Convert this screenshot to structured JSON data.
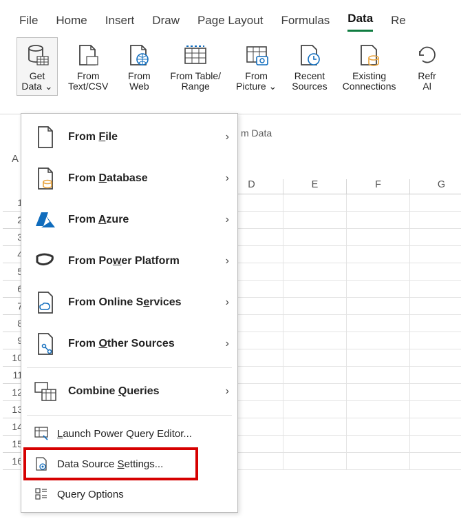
{
  "tabs": [
    "File",
    "Home",
    "Insert",
    "Draw",
    "Page Layout",
    "Formulas",
    "Data",
    "Re"
  ],
  "active_tab": "Data",
  "ribbon": {
    "get_data": {
      "top": "Get",
      "bottom": "Data ⌄"
    },
    "from_csv": {
      "top": "From",
      "bottom": "Text/CSV"
    },
    "from_web": {
      "top": "From",
      "bottom": "Web"
    },
    "from_table": {
      "top": "From Table/",
      "bottom": "Range"
    },
    "from_picture": {
      "top": "From",
      "bottom": "Picture ⌄"
    },
    "recent": {
      "top": "Recent",
      "bottom": "Sources"
    },
    "existing": {
      "top": "Existing",
      "bottom": "Connections"
    },
    "refresh": {
      "top": "Refr",
      "bottom": "Al"
    }
  },
  "group_label": "m Data",
  "namebox": "A",
  "columns": [
    "D",
    "E",
    "F",
    "G"
  ],
  "rows": [
    1,
    2,
    3,
    4,
    5,
    6,
    7,
    8,
    9,
    10,
    11,
    12,
    13,
    14,
    15,
    16
  ],
  "menu": {
    "from_file": "From File",
    "from_database": "From Database",
    "from_azure": "From Azure",
    "from_power": "From Power Platform",
    "from_online": "From Online Services",
    "from_other": "From Other Sources",
    "combine": "Combine Queries",
    "launch_pq": "Launch Power Query Editor...",
    "ds_settings": "Data Source Settings...",
    "query_opts": "Query Options"
  }
}
